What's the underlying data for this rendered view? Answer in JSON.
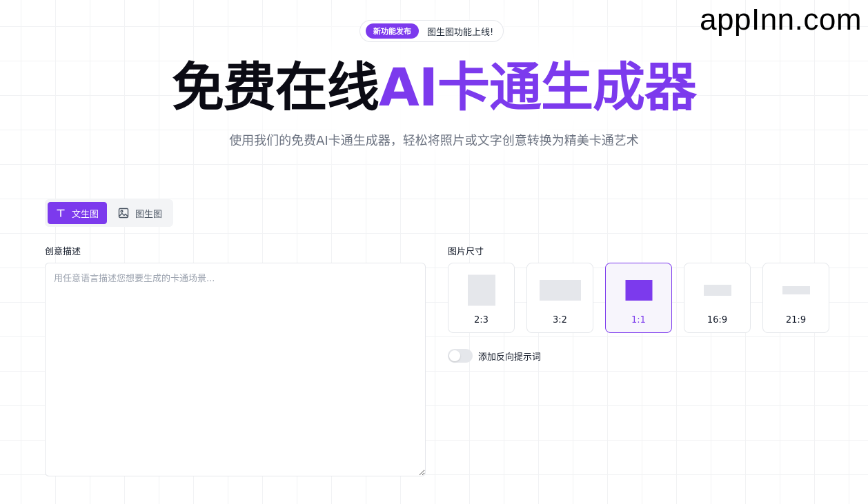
{
  "watermark": "appInn.com",
  "announcement": {
    "badge": "新功能发布",
    "message": "图生图功能上线!"
  },
  "hero": {
    "title_dark": "免费在线",
    "title_accent": "AI卡通生成器",
    "subtitle": "使用我们的免费AI卡通生成器，轻松将照片或文字创意转换为精美卡通艺术"
  },
  "mode_tabs": [
    {
      "label": "文生图",
      "icon": "text-t-icon",
      "active": true
    },
    {
      "label": "图生图",
      "icon": "image-icon",
      "active": false
    }
  ],
  "prompt": {
    "label": "创意描述",
    "placeholder": "用任意语言描述您想要生成的卡通场景...",
    "value": ""
  },
  "image_size": {
    "label": "图片尺寸",
    "options": [
      {
        "ratio": "2:3",
        "active": false
      },
      {
        "ratio": "3:2",
        "active": false
      },
      {
        "ratio": "1:1",
        "active": true
      },
      {
        "ratio": "16:9",
        "active": false
      },
      {
        "ratio": "21:9",
        "active": false
      }
    ]
  },
  "negative_prompt": {
    "label": "添加反向提示词",
    "enabled": false
  },
  "colors": {
    "accent": "#7c3aed"
  }
}
